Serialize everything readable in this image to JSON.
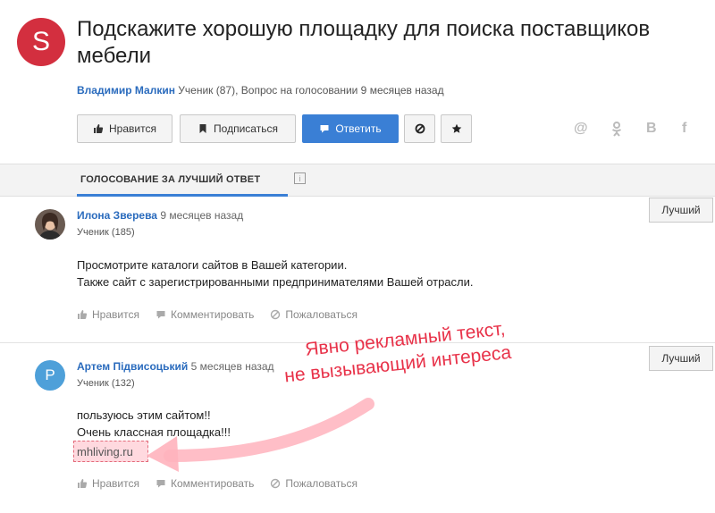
{
  "question": {
    "avatar_letter": "S",
    "title": "Подскажите хорошую площадку для поиска поставщиков мебели",
    "author": "Владимир Малкин",
    "meta": "Ученик (87), Вопрос на голосовании 9 месяцев назад"
  },
  "toolbar": {
    "like": "Нравится",
    "subscribe": "Подписаться",
    "answer": "Ответить"
  },
  "share": {
    "mail": "@",
    "ok": "ok-icon",
    "vk": "В",
    "fb": "f"
  },
  "tab": {
    "label": "ГОЛОСОВАНИЕ ЗА ЛУЧШИЙ ОТВЕТ",
    "info": "i"
  },
  "answers": [
    {
      "author": "Илона Зверева",
      "time": "9 месяцев назад",
      "rank": "Ученик (185)",
      "lines": [
        "Просмотрите каталоги сайтов в Вашей категории.",
        "Также сайт с зарегистрированными предпринимателями Вашей отрасли."
      ],
      "best_label": "Лучший"
    },
    {
      "avatar_letter": "P",
      "author": "Артем Підвисоцький",
      "time": "5 месяцев назад",
      "rank": "Ученик (132)",
      "lines": [
        "пользуюсь этим сайтом!!",
        "Очень классная площадка!!!"
      ],
      "link": "mhliving.ru",
      "best_label": "Лучший"
    }
  ],
  "actions": {
    "like": "Нравится",
    "comment": "Комментировать",
    "report": "Пожаловаться"
  },
  "annotation": {
    "line1": "Явно рекламный текст,",
    "line2": "не вызывающий интереса"
  },
  "colors": {
    "accent": "#3a7fd5",
    "link": "#2a6bbd",
    "avatar": "#d32f3f",
    "annotation": "#e8334a"
  }
}
